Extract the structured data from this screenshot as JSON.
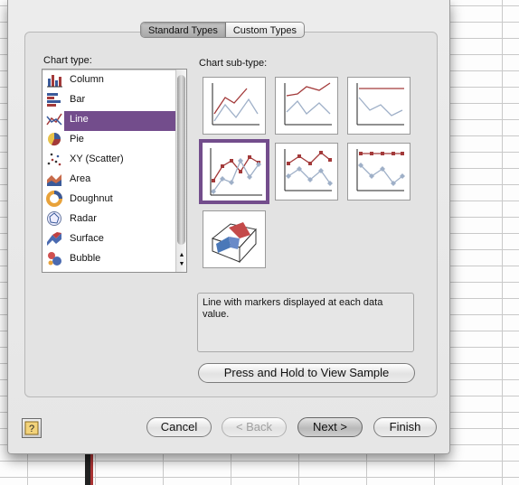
{
  "tabs": [
    {
      "label": "Standard Types",
      "active": true
    },
    {
      "label": "Custom Types",
      "active": false
    }
  ],
  "chart_type_label": "Chart type:",
  "chart_subtype_label": "Chart sub-type:",
  "chart_types": [
    {
      "label": "Column",
      "icon": "column-chart-icon"
    },
    {
      "label": "Bar",
      "icon": "bar-chart-icon"
    },
    {
      "label": "Line",
      "icon": "line-chart-icon",
      "selected": true
    },
    {
      "label": "Pie",
      "icon": "pie-chart-icon"
    },
    {
      "label": "XY (Scatter)",
      "icon": "scatter-chart-icon"
    },
    {
      "label": "Area",
      "icon": "area-chart-icon"
    },
    {
      "label": "Doughnut",
      "icon": "doughnut-chart-icon"
    },
    {
      "label": "Radar",
      "icon": "radar-chart-icon"
    },
    {
      "label": "Surface",
      "icon": "surface-chart-icon"
    },
    {
      "label": "Bubble",
      "icon": "bubble-chart-icon"
    }
  ],
  "subtypes": [
    {
      "name": "line",
      "selected": false
    },
    {
      "name": "stacked-line",
      "selected": false
    },
    {
      "name": "100-stacked-line",
      "selected": false
    },
    {
      "name": "line-with-markers",
      "selected": true
    },
    {
      "name": "stacked-line-with-markers",
      "selected": false
    },
    {
      "name": "100-stacked-line-with-markers",
      "selected": false
    },
    {
      "name": "3d-line",
      "selected": false
    }
  ],
  "description": "Line with markers displayed at each data value.",
  "sample_button": "Press and Hold to View Sample",
  "buttons": {
    "cancel": "Cancel",
    "back": "< Back",
    "next": "Next >",
    "finish": "Finish"
  },
  "colors": {
    "selection": "#734d8c",
    "series_red": "#a33a3a",
    "series_blue": "#9fb0c8"
  }
}
